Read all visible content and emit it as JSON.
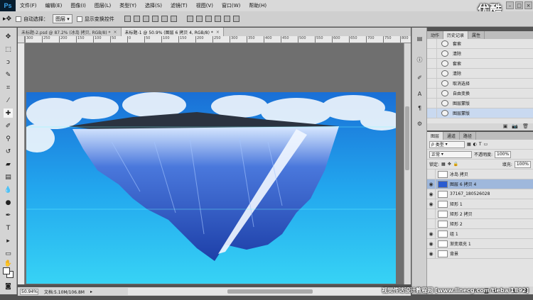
{
  "app": {
    "logo": "Ps",
    "brand": "优酷"
  },
  "menu": [
    "文件(F)",
    "编辑(E)",
    "图像(I)",
    "图层(L)",
    "类型(Y)",
    "选择(S)",
    "滤镜(T)",
    "视图(V)",
    "窗口(W)",
    "帮助(H)"
  ],
  "options": {
    "auto_select_label": "自动选择：",
    "auto_select_value": "图层",
    "transform_label": "显示变换控件"
  },
  "tabs": [
    {
      "label": "未标题-2.psd @ 87.2% (冰岛 拷贝, RGB/8) *",
      "active": false
    },
    {
      "label": "未标题-1 @ 50.9% (图层 6 拷贝 4, RGB/8) *",
      "active": true
    }
  ],
  "ruler_labels": [
    "300",
    "250",
    "200",
    "150",
    "100",
    "50",
    "0",
    "50",
    "100",
    "150",
    "200",
    "250",
    "300",
    "350",
    "400",
    "450",
    "500",
    "550",
    "600",
    "650",
    "700",
    "750",
    "800"
  ],
  "status": {
    "zoom": "50.94%",
    "doc": "文档:5.10M/106.8M"
  },
  "history": {
    "tabs": [
      "动作",
      "历史记录",
      "属性"
    ],
    "items": [
      {
        "label": "套索",
        "selected": false
      },
      {
        "label": "清除",
        "selected": false
      },
      {
        "label": "套索",
        "selected": false
      },
      {
        "label": "清除",
        "selected": false
      },
      {
        "label": "取消选择",
        "selected": false
      },
      {
        "label": "自由变换",
        "selected": false
      },
      {
        "label": "图层蒙版",
        "selected": false
      },
      {
        "label": "图层蒙版",
        "selected": true
      }
    ]
  },
  "layers": {
    "tabs": [
      "图层",
      "通道",
      "路径"
    ],
    "filter": "类型",
    "blend_mode": "正常",
    "opacity_label": "不透明度:",
    "opacity": "100%",
    "lock_label": "锁定:",
    "fill_label": "填充:",
    "fill": "100%",
    "items": [
      {
        "name": "冰岛 拷贝",
        "selected": false,
        "visible": false,
        "fx": ""
      },
      {
        "name": "图层 6 拷贝 4",
        "selected": true,
        "visible": true,
        "fx": ""
      },
      {
        "name": "37167_180526028",
        "selected": false,
        "visible": true,
        "fx": ""
      },
      {
        "name": "矩形 1",
        "selected": false,
        "visible": true,
        "fx": ""
      },
      {
        "name": "矩形 2 拷贝",
        "selected": false,
        "visible": false,
        "fx": ""
      },
      {
        "name": "矩形 2",
        "selected": false,
        "visible": false,
        "fx": ""
      },
      {
        "name": "组 1",
        "selected": false,
        "visible": true,
        "fx": ""
      },
      {
        "name": "渐变填充 1",
        "selected": false,
        "visible": true,
        "fx": ""
      },
      {
        "name": "背景",
        "selected": false,
        "visible": true,
        "fx": ""
      }
    ]
  },
  "watermark": "视觉传达设计教程网 [www.linecg.com/tieba/1892]",
  "colors": {
    "sky_top": "#1a6fd6",
    "sky_bottom": "#37d3f5",
    "ice": "#2a5bd0",
    "menubar": "#d9d9d9"
  }
}
